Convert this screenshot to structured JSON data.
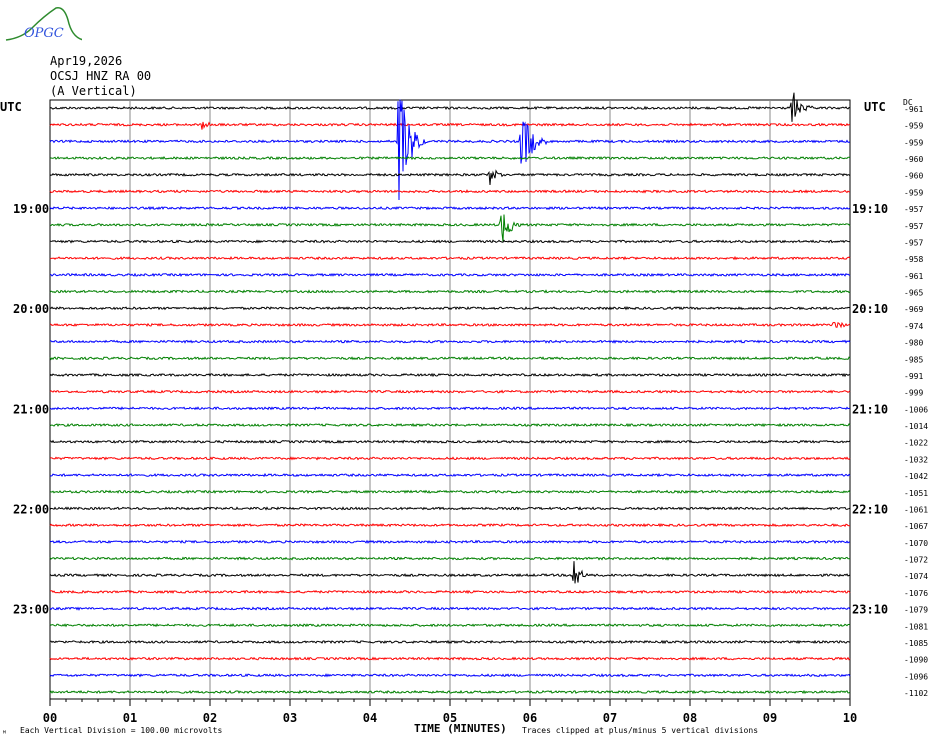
{
  "logo_text": "OPGC",
  "header": {
    "date": "Apr19,2026",
    "station": "OCSJ HNZ RA 00",
    "component": "(A Vertical)"
  },
  "left_top_label": "UTC",
  "right_top_label": "UTC",
  "dc_label": "DC",
  "footer": {
    "scale_note": "Each Vertical Division =  100.00 microvolts",
    "axis_title": "TIME (MINUTES)",
    "clip_note": "Traces clipped at plus/minus 5 vertical divisions",
    "corner_mark": "ᴹ"
  },
  "chart_data": {
    "type": "line",
    "subtype": "helicorder",
    "xlabel": "TIME (MINUTES)",
    "xlim": [
      0,
      10
    ],
    "x_ticks": [
      "00",
      "01",
      "02",
      "03",
      "04",
      "05",
      "06",
      "07",
      "08",
      "09",
      "10"
    ],
    "grid": true,
    "trace_colors": [
      "#000000",
      "#ff0000",
      "#0000ff",
      "#008000"
    ],
    "left_hour_labels": [
      {
        "trace": 6,
        "text": "19:00"
      },
      {
        "trace": 12,
        "text": "20:00"
      },
      {
        "trace": 18,
        "text": "21:00"
      },
      {
        "trace": 24,
        "text": "22:00"
      },
      {
        "trace": 30,
        "text": "23:00"
      }
    ],
    "right_hour_labels": [
      {
        "trace": 6,
        "text": "19:10"
      },
      {
        "trace": 12,
        "text": "20:10"
      },
      {
        "trace": 18,
        "text": "21:10"
      },
      {
        "trace": 24,
        "text": "22:10"
      },
      {
        "trace": 30,
        "text": "23:10"
      }
    ],
    "dc_offsets": [
      "-961",
      "-959",
      "-959",
      "-960",
      "-960",
      "-959",
      "-957",
      "-957",
      "-957",
      "-958",
      "-961",
      "-965",
      "-969",
      "-974",
      "-980",
      "-985",
      "-991",
      "-999",
      "-1006",
      "-1014",
      "-1022",
      "-1032",
      "-1042",
      "-1051",
      "-1061",
      "-1067",
      "-1070",
      "-1072",
      "-1074",
      "-1076",
      "-1079",
      "-1081",
      "-1085",
      "-1090",
      "-1096",
      "-1102"
    ],
    "events": [
      {
        "trace": 0,
        "minute": 9.28,
        "amplitude_div": 1.4,
        "duration_min": 0.25
      },
      {
        "trace": 1,
        "minute": 1.9,
        "amplitude_div": 0.35,
        "duration_min": 0.3
      },
      {
        "trace": 2,
        "minute": 4.35,
        "amplitude_div": 5,
        "duration_min": 0.35
      },
      {
        "trace": 2,
        "minute": 5.9,
        "amplitude_div": 2.3,
        "duration_min": 0.35
      },
      {
        "trace": 4,
        "minute": 5.5,
        "amplitude_div": 0.7,
        "duration_min": 0.25
      },
      {
        "trace": 7,
        "minute": 5.65,
        "amplitude_div": 1.2,
        "duration_min": 0.35
      },
      {
        "trace": 13,
        "minute": 9.8,
        "amplitude_div": 0.3,
        "duration_min": 0.3
      },
      {
        "trace": 28,
        "minute": 6.55,
        "amplitude_div": 1.3,
        "duration_min": 0.2
      }
    ]
  }
}
